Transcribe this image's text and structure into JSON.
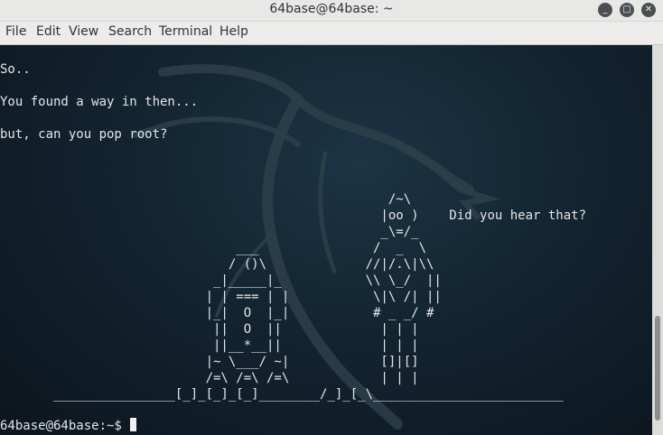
{
  "window": {
    "title": "64base@64base: ~",
    "minimize_icon": "_",
    "maximize_icon": "□",
    "close_icon": "✕"
  },
  "menu": [
    "File",
    "Edit",
    "View",
    "Search",
    "Terminal",
    "Help"
  ],
  "terminal": {
    "lines": [
      "So..",
      "You found a way in then...",
      "but, can you pop root?",
      "                                                   /~\\",
      "                                                  |oo )    Did you hear that?",
      "                                                  _\\=/_",
      "                               ___               /  _  \\",
      "                              / ()\\             //|/.\\|\\\\",
      "                            _|_____|_           \\\\ \\_/  ||",
      "                           | | === | |           \\|\\ /| ||",
      "                           |_|  O  |_|           # _ _/ #",
      "                            ||  O  ||             | | |",
      "                            ||__*__||             | | |",
      "                           |~ \\___/ ~|            []|[]",
      "                           /=\\ /=\\ /=\\            | | |",
      "       ________________[_]_[_]_[_]________/_]_[_\\_________________________"
    ],
    "prompt": "64base@64base:~$ "
  }
}
